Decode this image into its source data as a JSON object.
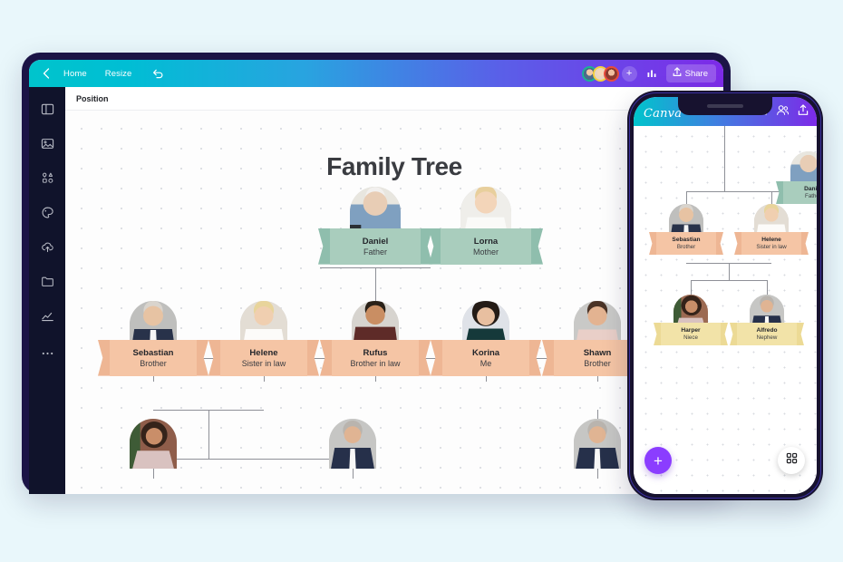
{
  "page": {
    "background_color": "#e9f7fb"
  },
  "tablet": {
    "topbar": {
      "back_icon": "chevron-left-icon",
      "home_label": "Home",
      "resize_label": "Resize",
      "undo_icon": "undo-icon",
      "add_collaborator_label": "+",
      "analytics_icon": "bar-chart-icon",
      "share_icon": "share-upload-icon",
      "share_label": "Share",
      "gradient_from": "#00c4cc",
      "gradient_to": "#7d2ae8"
    },
    "sidebar": {
      "items": [
        {
          "icon": "design-layout-icon"
        },
        {
          "icon": "image-icon"
        },
        {
          "icon": "elements-icon"
        },
        {
          "icon": "brand-palette-icon"
        },
        {
          "icon": "cloud-upload-icon"
        },
        {
          "icon": "folder-icon"
        },
        {
          "icon": "trend-chart-icon"
        },
        {
          "icon": "more-dots-icon"
        }
      ]
    },
    "subbar": {
      "position_label": "Position"
    },
    "canvas": {
      "title": "Family Tree"
    }
  },
  "tree": {
    "generation_1": [
      {
        "name": "Daniel",
        "role": "Father",
        "palette": "green"
      },
      {
        "name": "Lorna",
        "role": "Mother",
        "palette": "green"
      }
    ],
    "generation_2": [
      {
        "name": "Sebastian",
        "role": "Brother",
        "palette": "peach"
      },
      {
        "name": "Helene",
        "role": "Sister in law",
        "palette": "peach"
      },
      {
        "name": "Rufus",
        "role": "Brother in law",
        "palette": "peach"
      },
      {
        "name": "Korina",
        "role": "Me",
        "palette": "peach"
      },
      {
        "name": "Shawn",
        "role": "Brother",
        "palette": "peach"
      }
    ],
    "generation_3_partial": [
      {
        "name": "",
        "role": ""
      },
      {
        "name": "",
        "role": ""
      },
      {
        "name": "",
        "role": ""
      }
    ]
  },
  "phone": {
    "topbar": {
      "logo": "Canva",
      "more_icon": "more-dots-icon",
      "collaborate_icon": "people-icon",
      "share_icon": "share-upload-icon",
      "gradient_from": "#00c4cc",
      "gradient_to": "#7d2ae8"
    },
    "cards": [
      {
        "name": "Daniel",
        "role": "Father",
        "palette": "green"
      },
      {
        "name": "Sebastian",
        "role": "Brother",
        "palette": "peach"
      },
      {
        "name": "Helene",
        "role": "Sister in law",
        "palette": "peach"
      },
      {
        "name": "Harper",
        "role": "Niece",
        "palette": "yellow"
      },
      {
        "name": "Alfredo",
        "role": "Nephew",
        "palette": "yellow"
      }
    ],
    "add_button_label": "+",
    "grid_button_icon": "grid-icon",
    "accent_color": "#8b3dff"
  }
}
